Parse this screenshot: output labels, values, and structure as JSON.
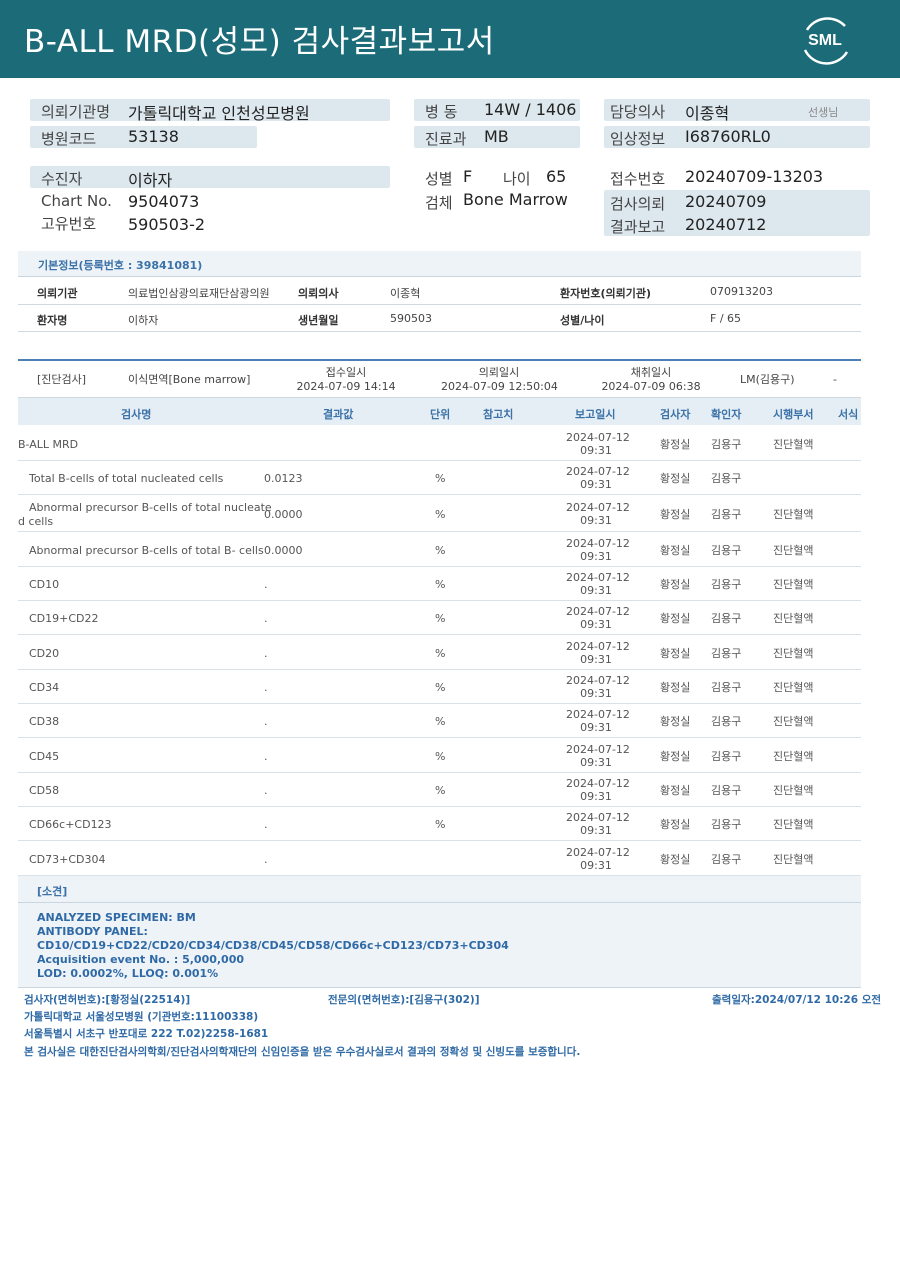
{
  "report": {
    "title": "B-ALL  MRD(성모) 검사결과보고서",
    "logo_text": "SML"
  },
  "info": {
    "req_inst_label": "의뢰기관명",
    "req_inst": "가톨릭대학교 인천성모병원",
    "hosp_code_label": "병원코드",
    "hosp_code": "53138",
    "ward_label": "병  동",
    "ward": "14W / 1406",
    "dept_label": "진료과",
    "dept": "MB",
    "doctor_label": "담당의사",
    "doctor": "이종혁",
    "doctor_suffix": "선생님",
    "clinical_label": "임상정보",
    "clinical": "I68760RL0",
    "patient_label": "수진자",
    "patient": "이하자",
    "chart_label": "Chart No.",
    "chart": "9504073",
    "unique_label": "고유번호",
    "unique": "590503-2",
    "sex_label": "성별",
    "sex": "F",
    "age_label": "나이",
    "age": "65",
    "specimen_label": "검체",
    "specimen": "Bone Marrow",
    "receipt_label": "접수번호",
    "receipt": "20240709-13203",
    "request_label": "검사의뢰",
    "request": "20240709",
    "result_label": "결과보고",
    "result": "20240712"
  },
  "basic": {
    "heading": "기본정보(등록번호 : 39841081)",
    "inst_label": "의뢰기관",
    "inst": "의료법인삼광의료재단삼광의원",
    "doc_label": "의뢰의사",
    "doc": "이종혁",
    "pno_label": "환자번호(의뢰기관)",
    "pno": "070913203",
    "name_label": "환자명",
    "name": "이하자",
    "birth_label": "생년월일",
    "birth": "590503",
    "sexage_label": "성별/나이",
    "sexage": "F / 65"
  },
  "exam": {
    "category": "[진단검사]",
    "test": "이식면역[Bone marrow]",
    "receipt_label": "접수일시",
    "receipt_dt": "2024-07-09 14:14",
    "request_label": "의뢰일시",
    "request_dt": "2024-07-09 12:50:04",
    "collect_label": "채취일시",
    "collect_dt": "2024-07-09 06:38",
    "lm": "LM(김용구)",
    "dash": "-"
  },
  "table": {
    "headers": [
      "검사명",
      "결과값",
      "단위",
      "참고치",
      "보고일시",
      "검사자",
      "확인자",
      "시행부서",
      "서식"
    ],
    "rows": [
      {
        "name": "B-ALL MRD",
        "name2": "",
        "value": "",
        "unit": "",
        "date": "2024-07-12",
        "time": "09:31",
        "tester": "황정실",
        "checker": "김용구",
        "dept": "진단혈액"
      },
      {
        "name": "Total B-cells of total nucleated cells",
        "name2": "",
        "value": "0.0123",
        "unit": "%",
        "date": "2024-07-12",
        "time": "09:31",
        "tester": "황정실",
        "checker": "김용구",
        "dept": ""
      },
      {
        "name": "Abnormal precursor B-cells of total nucleate",
        "name2": "d cells",
        "value": "0.0000",
        "unit": "%",
        "date": "2024-07-12",
        "time": "09:31",
        "tester": "황정실",
        "checker": "김용구",
        "dept": "진단혈액"
      },
      {
        "name": "Abnormal precursor B-cells of total B- cells",
        "name2": "",
        "value": "0.0000",
        "unit": "%",
        "date": "2024-07-12",
        "time": "09:31",
        "tester": "황정실",
        "checker": "김용구",
        "dept": "진단혈액"
      },
      {
        "name": "CD10",
        "name2": "",
        "value": ".",
        "unit": "%",
        "date": "2024-07-12",
        "time": "09:31",
        "tester": "황정실",
        "checker": "김용구",
        "dept": "진단혈액"
      },
      {
        "name": "CD19+CD22",
        "name2": "",
        "value": ".",
        "unit": "%",
        "date": "2024-07-12",
        "time": "09:31",
        "tester": "황정실",
        "checker": "김용구",
        "dept": "진단혈액"
      },
      {
        "name": "CD20",
        "name2": "",
        "value": ".",
        "unit": "%",
        "date": "2024-07-12",
        "time": "09:31",
        "tester": "황정실",
        "checker": "김용구",
        "dept": "진단혈액"
      },
      {
        "name": "CD34",
        "name2": "",
        "value": ".",
        "unit": "%",
        "date": "2024-07-12",
        "time": "09:31",
        "tester": "황정실",
        "checker": "김용구",
        "dept": "진단혈액"
      },
      {
        "name": "CD38",
        "name2": "",
        "value": ".",
        "unit": "%",
        "date": "2024-07-12",
        "time": "09:31",
        "tester": "황정실",
        "checker": "김용구",
        "dept": "진단혈액"
      },
      {
        "name": "CD45",
        "name2": "",
        "value": ".",
        "unit": "%",
        "date": "2024-07-12",
        "time": "09:31",
        "tester": "황정실",
        "checker": "김용구",
        "dept": "진단혈액"
      },
      {
        "name": "CD58",
        "name2": "",
        "value": ".",
        "unit": "%",
        "date": "2024-07-12",
        "time": "09:31",
        "tester": "황정실",
        "checker": "김용구",
        "dept": "진단혈액"
      },
      {
        "name": "CD66c+CD123",
        "name2": "",
        "value": ".",
        "unit": "%",
        "date": "2024-07-12",
        "time": "09:31",
        "tester": "황정실",
        "checker": "김용구",
        "dept": "진단혈액"
      },
      {
        "name": "CD73+CD304",
        "name2": "",
        "value": ".",
        "unit": "",
        "date": "2024-07-12",
        "time": "09:31",
        "tester": "황정실",
        "checker": "김용구",
        "dept": "진단혈액"
      }
    ]
  },
  "conclusion": {
    "heading": "[소견]",
    "lines": [
      "ANALYZED SPECIMEN: BM",
      "ANTIBODY PANEL:",
      "CD10/CD19+CD22/CD20/CD34/CD38/CD45/CD58/CD66c+CD123/CD73+CD304",
      "Acquisition event No. : 5,000,000",
      "LOD: 0.0002%, LLOQ: 0.001%"
    ]
  },
  "footer": {
    "tester": "검사자(면허번호):[황정실(22514)]",
    "specialist": "전문의(면허번호):[김용구(302)]",
    "printed": "출력일자:2024/07/12 10:26 오전",
    "hospital": "가톨릭대학교 서울성모병원 (기관번호:11100338)",
    "address": "서울특별시 서초구 반포대로 222 T.02)2258-1681",
    "certification": "본 검사실은 대한진단검사의학회/진단검사의학재단의 신임인증을 받은 우수검사실로서 결과의 정확성 및 신빙도를 보증합니다."
  },
  "colors": {
    "banner": "#1b6b78",
    "accent": "#3b72a8",
    "pill": "#dde8ee"
  }
}
